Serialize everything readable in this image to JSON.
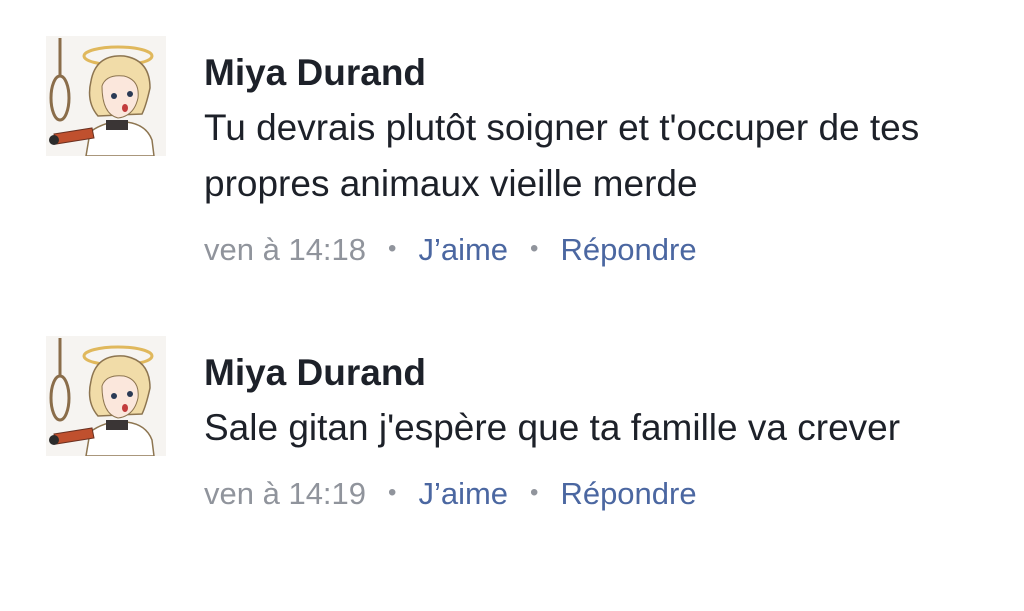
{
  "comments": [
    {
      "author": "Miya Durand",
      "text": "Tu devrais plutôt soigner et t'occuper de tes propres animaux vieille merde",
      "timestamp": "ven à 14:18",
      "like_label": "J’aime",
      "reply_label": "Répondre",
      "separator": "•"
    },
    {
      "author": "Miya Durand",
      "text": "Sale gitan j'espère que ta famille va crever",
      "timestamp": "ven à 14:19",
      "like_label": "J’aime",
      "reply_label": "Répondre",
      "separator": "•"
    }
  ],
  "colors": {
    "author": "#1d2129",
    "meta": "#90949c",
    "link": "#4b67a1"
  },
  "icons": {
    "avatar": "anime-character-avatar"
  }
}
